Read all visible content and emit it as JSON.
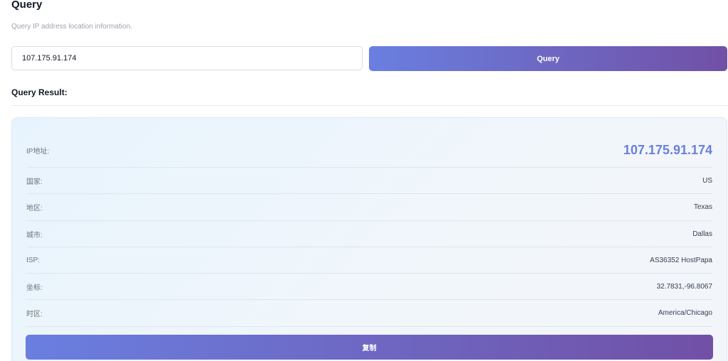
{
  "header": {
    "title": "Query",
    "subtitle": "Query IP address location information."
  },
  "search": {
    "value": "107.175.91.174",
    "button_label": "Query"
  },
  "result": {
    "heading": "Query Result:",
    "rows": [
      {
        "label": "IP地址:",
        "value": "107.175.91.174"
      },
      {
        "label": "国家:",
        "value": "US"
      },
      {
        "label": "地区:",
        "value": "Texas"
      },
      {
        "label": "城市:",
        "value": "Dallas"
      },
      {
        "label": "ISP:",
        "value": "AS36352 HostPapa"
      },
      {
        "label": "坐标:",
        "value": "32.7831,-96.8067"
      },
      {
        "label": "时区:",
        "value": "America/Chicago"
      }
    ],
    "copy_label": "复制"
  },
  "colors": {
    "accent_start": "#6a7fe0",
    "accent_end": "#7150a6",
    "ip_highlight": "#6b7fdc"
  }
}
